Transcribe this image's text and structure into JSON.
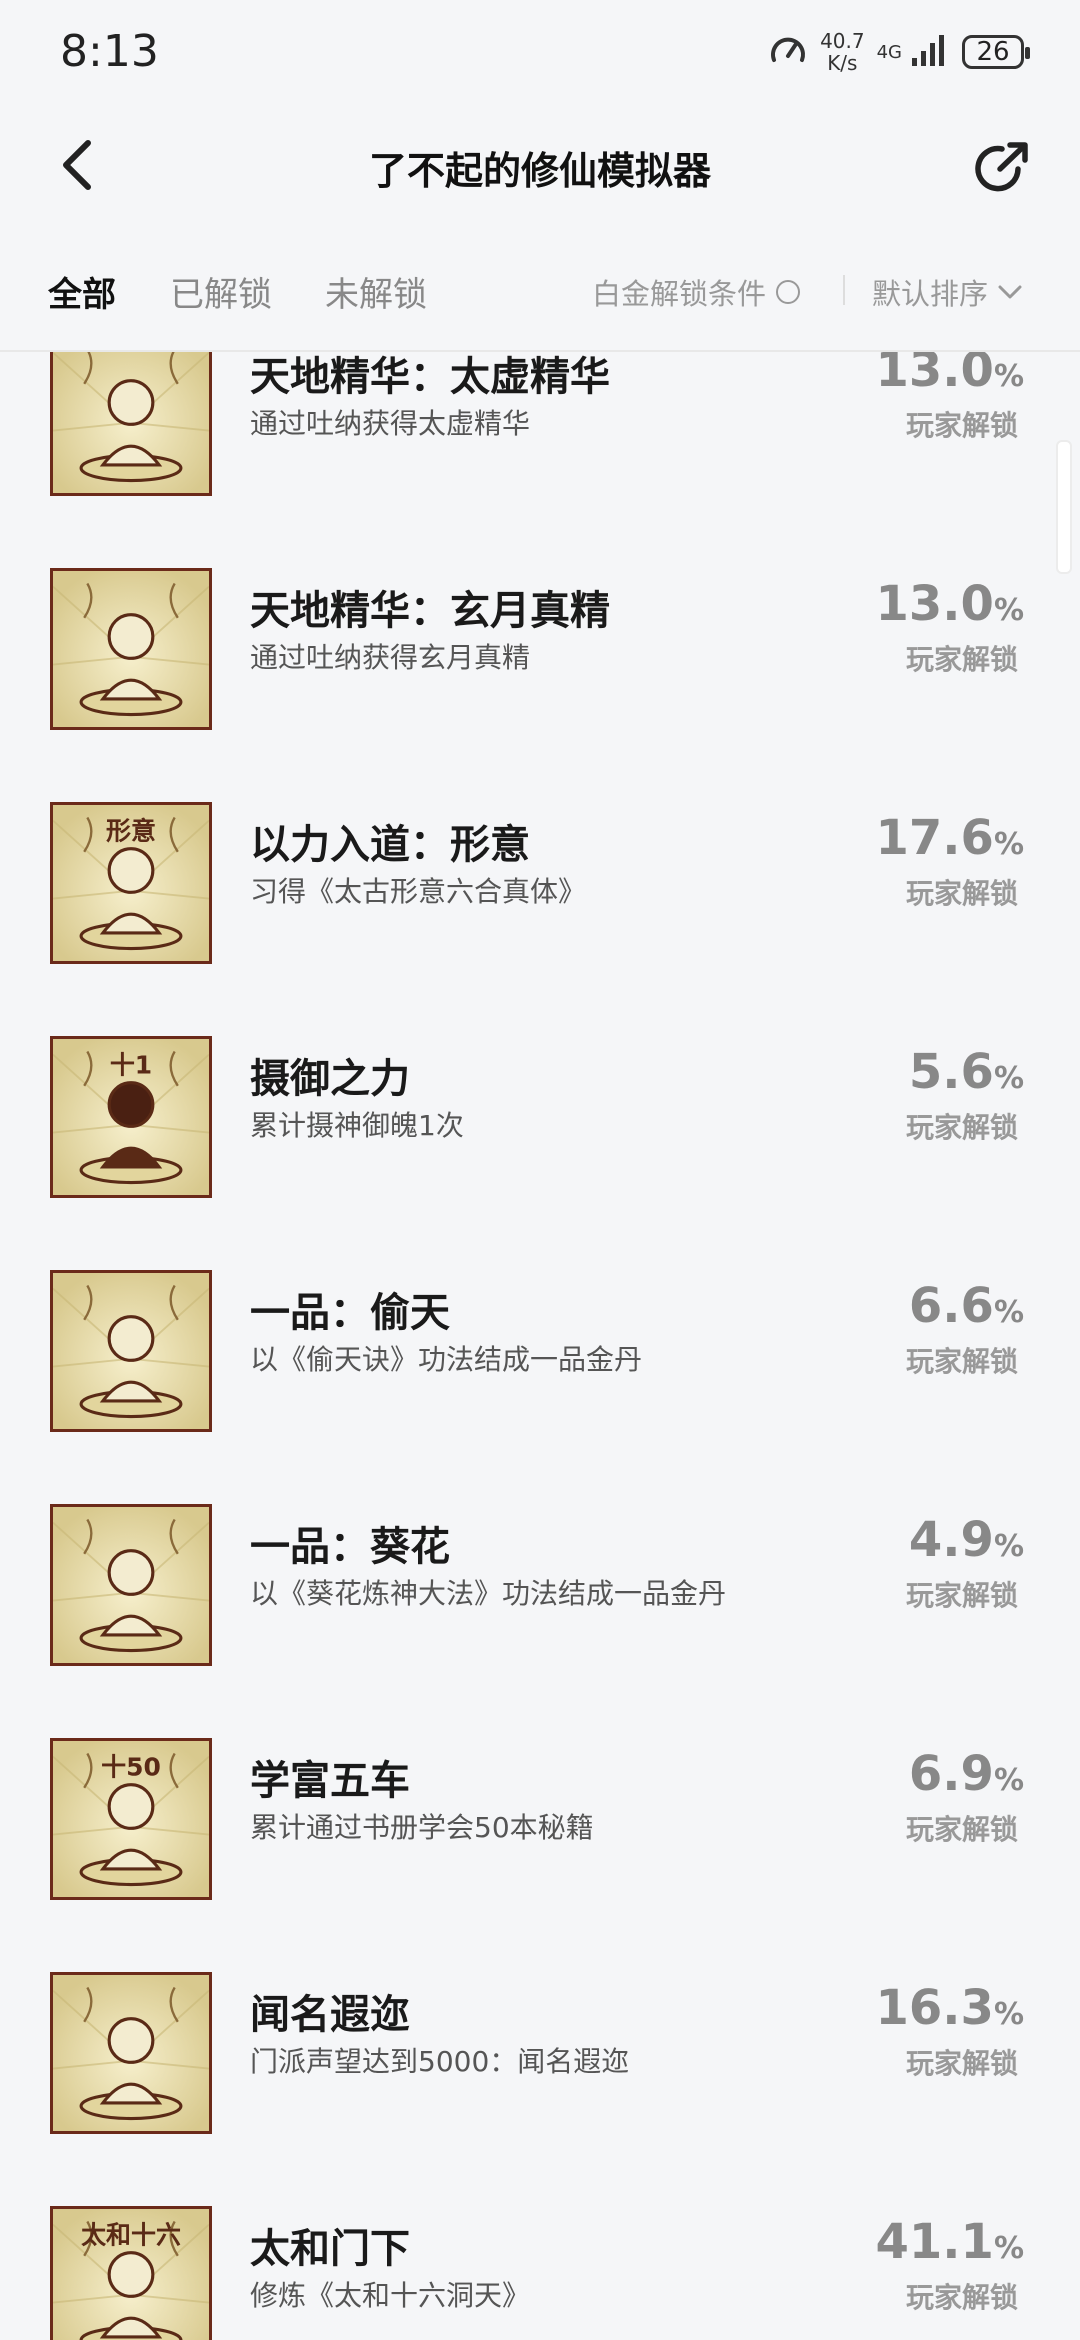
{
  "status": {
    "time": "8:13",
    "speed_value": "40.7",
    "speed_unit": "K/s",
    "network": "4G",
    "battery": "26"
  },
  "header": {
    "title": "了不起的修仙模拟器"
  },
  "tabs": [
    {
      "label": "全部"
    },
    {
      "label": "已解锁"
    },
    {
      "label": "未解锁"
    }
  ],
  "filter": {
    "label": "白金解锁条件"
  },
  "sort": {
    "label": "默认排序"
  },
  "unlock_label": "玩家解锁",
  "pct_symbol": "%",
  "achievements": [
    {
      "name": "天地精华：太虚精华",
      "desc": "通过吐纳获得太虚精华",
      "percent": "13.0",
      "icon": "meditating-figure-icon"
    },
    {
      "name": "天地精华：玄月真精",
      "desc": "通过吐纳获得玄月真精",
      "percent": "13.0",
      "icon": "meditating-figure-icon"
    },
    {
      "name": "以力入道：形意",
      "desc": "习得《太古形意六合真体》",
      "percent": "17.6",
      "icon": "calligraphy-figure-icon"
    },
    {
      "name": "摄御之力",
      "desc": "累计摄神御魄1次",
      "percent": "5.6",
      "icon": "dark-figure-pedestal-icon"
    },
    {
      "name": "一品：偷天",
      "desc": "以《偷天诀》功法结成一品金丹",
      "percent": "6.6",
      "icon": "figure-pedestal-icon"
    },
    {
      "name": "一品：葵花",
      "desc": "以《葵花炼神大法》功法结成一品金丹",
      "percent": "4.9",
      "icon": "figure-pedestal-icon"
    },
    {
      "name": "学富五车",
      "desc": "累计通过书册学会50本秘籍",
      "percent": "6.9",
      "icon": "books-icon"
    },
    {
      "name": "闻名遐迩",
      "desc": "门派声望达到5000：闻名遐迩",
      "percent": "16.3",
      "icon": "clouds-figure-icon"
    },
    {
      "name": "太和门下",
      "desc": "修炼《太和十六洞天》",
      "percent": "41.1",
      "icon": "scroll-figure-icon"
    }
  ],
  "thumb_glyphs": [
    "",
    "",
    "形意",
    "十1",
    "",
    "",
    "十50",
    "",
    "太和十六"
  ],
  "colors": {
    "frame": "#6b2a1a",
    "parchment": "#e9dfb5"
  }
}
